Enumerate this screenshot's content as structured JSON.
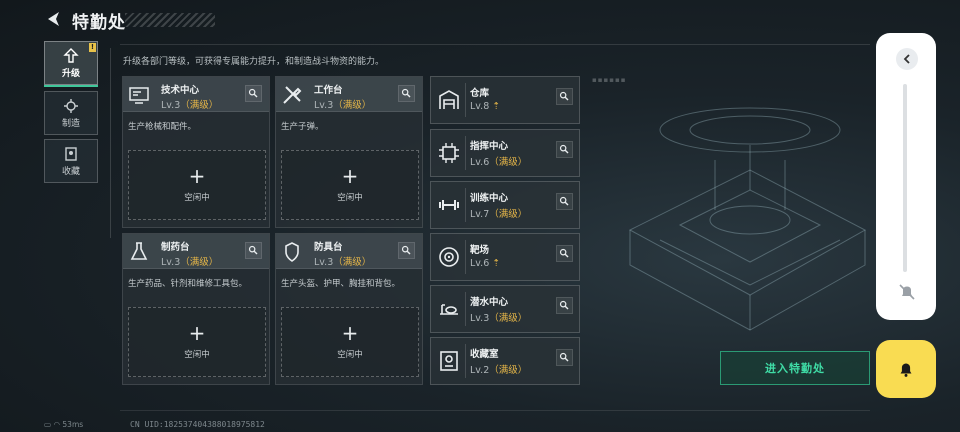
{
  "header": {
    "title": "特勤处"
  },
  "tabs": [
    {
      "label": "升级",
      "badge": "!",
      "icon": "upgrade-icon",
      "active": true
    },
    {
      "label": "制造",
      "icon": "craft-icon",
      "active": false
    },
    {
      "label": "收藏",
      "icon": "collection-icon",
      "active": false
    }
  ],
  "intro": "升级各部门等级，可获得专属能力提升，和制造战斗物资的能力。",
  "cards": [
    {
      "name": "技术中心",
      "level": "Lv.3",
      "max": "（满级）",
      "desc": "生产枪械和配件。",
      "slot": "空闲中",
      "icon": "monitor-icon"
    },
    {
      "name": "工作台",
      "level": "Lv.3",
      "max": "（满级）",
      "desc": "生产子弹。",
      "slot": "空闲中",
      "icon": "tools-icon"
    },
    {
      "name": "制药台",
      "level": "Lv.3",
      "max": "（满级）",
      "desc": "生产药品、针剂和维修工具包。",
      "slot": "空闲中",
      "icon": "flask-icon"
    },
    {
      "name": "防具台",
      "level": "Lv.3",
      "max": "（满级）",
      "desc": "生产头盔、护甲、胸挂和背包。",
      "slot": "空闲中",
      "icon": "armor-icon"
    }
  ],
  "facilities": [
    {
      "name": "仓库",
      "level": "Lv.8",
      "max": "",
      "upgradable": true,
      "icon": "warehouse-icon"
    },
    {
      "name": "指挥中心",
      "level": "Lv.6",
      "max": "（满级）",
      "upgradable": false,
      "icon": "chip-icon"
    },
    {
      "name": "训练中心",
      "level": "Lv.7",
      "max": "（满级）",
      "upgradable": false,
      "icon": "dumbbell-icon"
    },
    {
      "name": "靶场",
      "level": "Lv.6",
      "max": "",
      "upgradable": true,
      "icon": "target-icon"
    },
    {
      "name": "潜水中心",
      "level": "Lv.3",
      "max": "（满级）",
      "upgradable": false,
      "icon": "diving-icon"
    },
    {
      "name": "收藏室",
      "level": "Lv.2",
      "max": "（满级）",
      "upgradable": false,
      "icon": "vault-icon"
    }
  ],
  "enter_button": "进入特勤处",
  "footer": {
    "ping": "53ms",
    "uid": "CN UID:182537404388018975812"
  },
  "colors": {
    "accent_green": "#3fc79a",
    "max_gold": "#e4b548",
    "bell_yellow": "#f9dc52"
  }
}
